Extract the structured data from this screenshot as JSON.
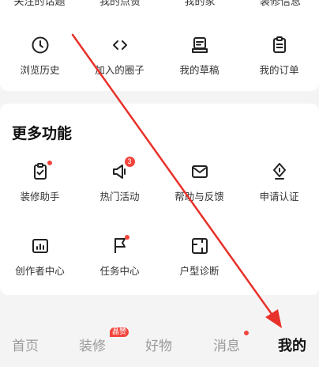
{
  "top_partial_row": [
    "关注的话题",
    "我的点赞",
    "我的家",
    "装修信息"
  ],
  "top_row": [
    {
      "label": "浏览历史",
      "icon": "clock-icon"
    },
    {
      "label": "加入的圈子",
      "icon": "code-brackets-icon"
    },
    {
      "label": "我的草稿",
      "icon": "draft-box-icon"
    },
    {
      "label": "我的订单",
      "icon": "order-clipboard-icon"
    }
  ],
  "more_section": {
    "title": "更多功能",
    "items": [
      {
        "label": "装修助手",
        "icon": "clipboard-check-icon"
      },
      {
        "label": "热门活动",
        "icon": "megaphone-icon",
        "badge": "3"
      },
      {
        "label": "帮助与反馈",
        "icon": "mail-icon"
      },
      {
        "label": "申请认证",
        "icon": "certificate-icon"
      },
      {
        "label": "创作者中心",
        "icon": "chart-bars-icon"
      },
      {
        "label": "任务中心",
        "icon": "flag-icon"
      },
      {
        "label": "户型诊断",
        "icon": "floor-plan-icon"
      }
    ]
  },
  "tabbar": {
    "tabs": [
      "首页",
      "装修",
      "好物",
      "消息",
      "我的"
    ],
    "active": "我的",
    "decor_badge": "晶赞"
  },
  "colors": {
    "accent_red": "#f2453d",
    "annotation_arrow": "#e8312a"
  }
}
